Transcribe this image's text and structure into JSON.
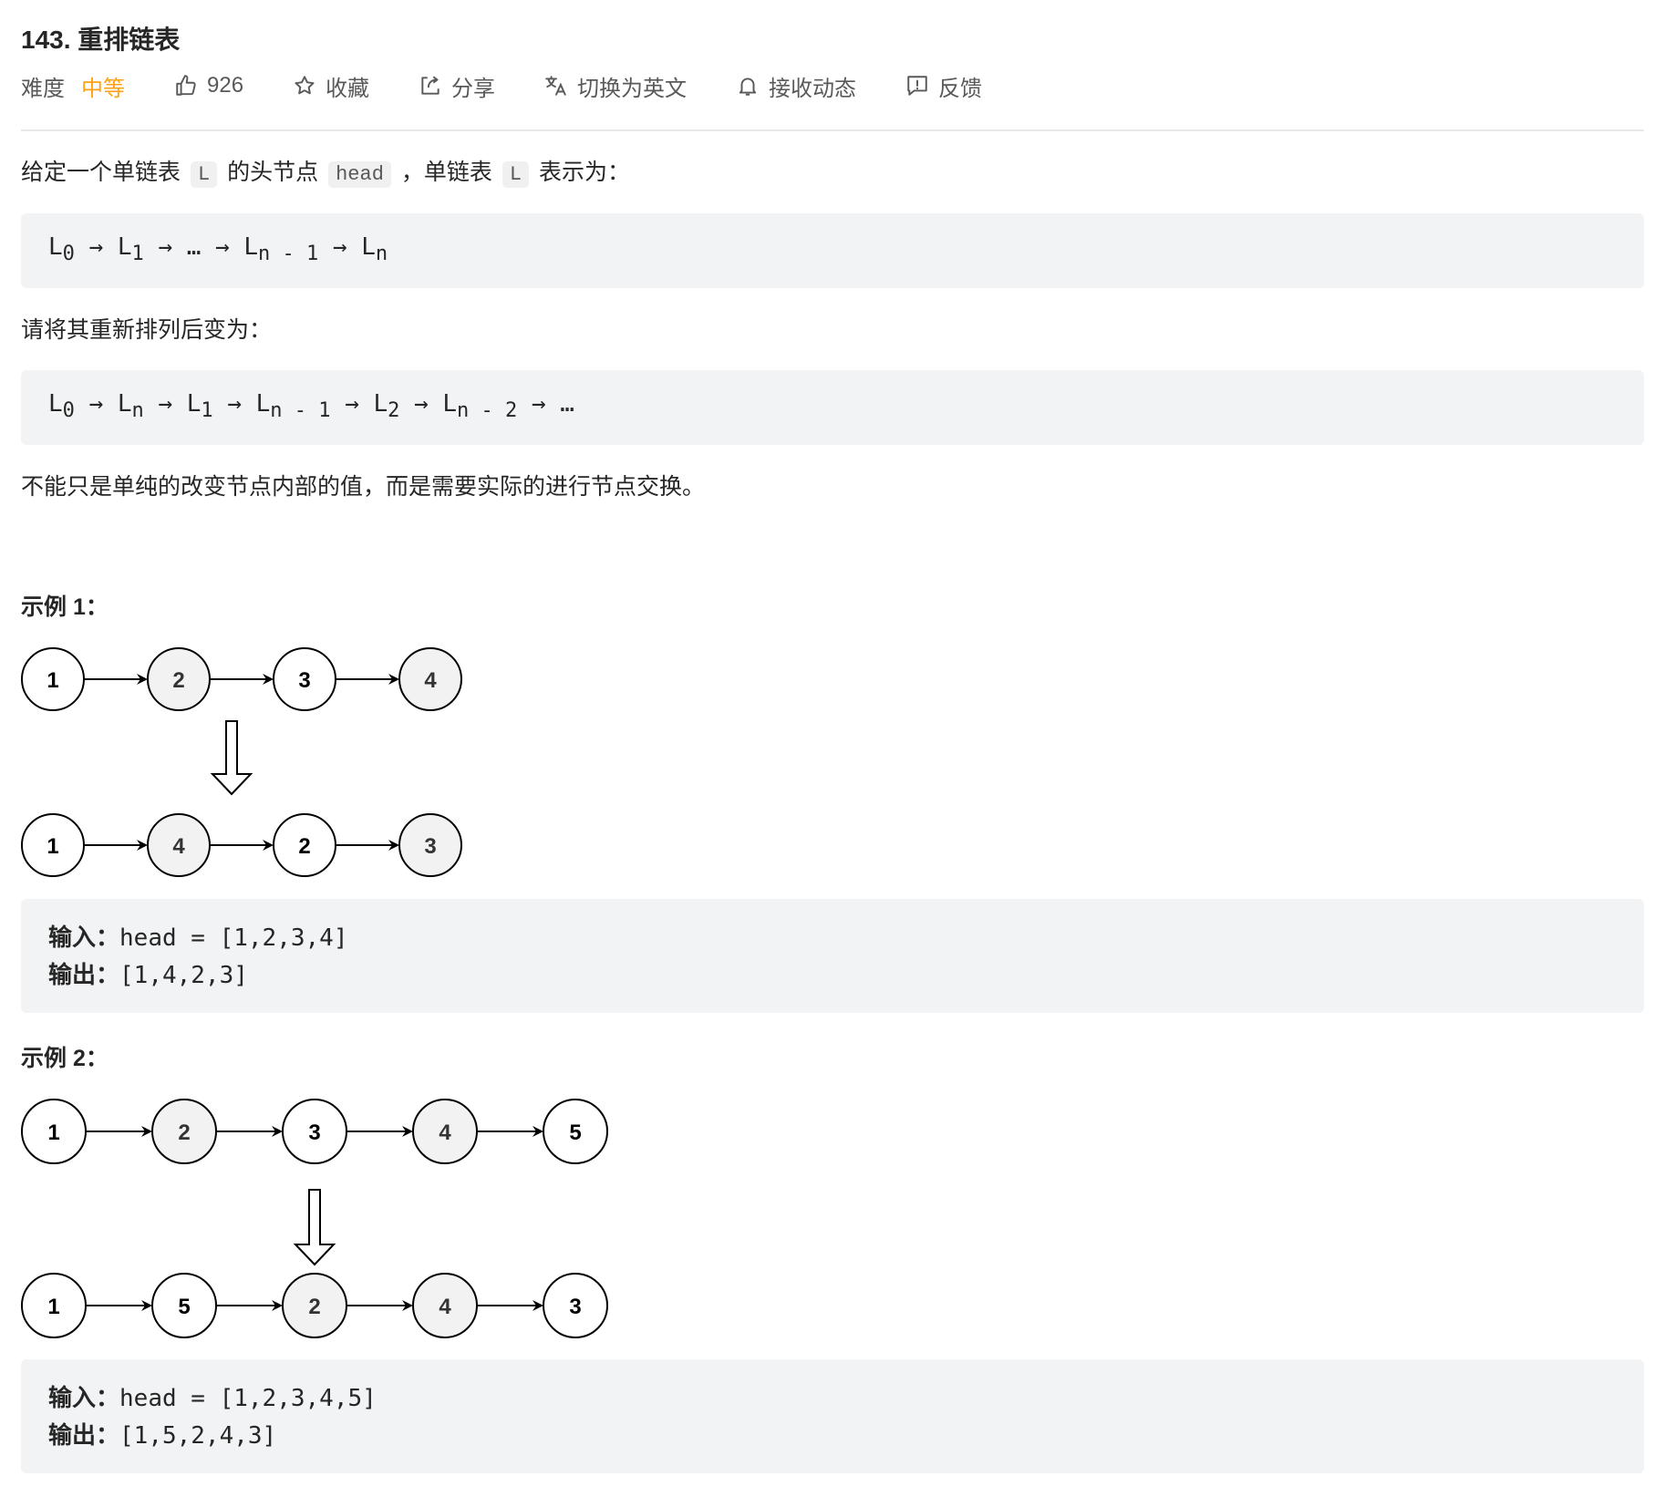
{
  "problem": {
    "title": "143. 重排链表",
    "difficulty_label": "难度",
    "difficulty_value": "中等",
    "likes": "926",
    "collect_label": "收藏",
    "share_label": "分享",
    "switch_lang_label": "切换为英文",
    "subscribe_label": "接收动态",
    "feedback_label": "反馈"
  },
  "desc": {
    "intro_pre": "给定一个单链表",
    "code_L": "L",
    "intro_mid": "的头节点",
    "code_head": "head",
    "intro_mid2": "，单链表",
    "code_L2": "L",
    "intro_post": "表示为：",
    "sequence1": "L0 → L1 → … → Ln - 1 → Ln",
    "reorder_text": "请将其重新排列后变为：",
    "sequence2": "L0 → Ln → L1 → Ln - 1 → L2 → Ln - 2 → …",
    "note": "不能只是单纯的改变节点内部的值，而是需要实际的进行节点交换。"
  },
  "examples": [
    {
      "title": "示例 1：",
      "before": [
        "1",
        "2",
        "3",
        "4"
      ],
      "after": [
        "1",
        "4",
        "2",
        "3"
      ],
      "input_label": "输入：",
      "input_value": "head = [1,2,3,4]",
      "output_label": "输出：",
      "output_value": "[1,4,2,3]"
    },
    {
      "title": "示例 2：",
      "before": [
        "1",
        "2",
        "3",
        "4",
        "5"
      ],
      "after": [
        "1",
        "5",
        "2",
        "4",
        "3"
      ],
      "input_label": "输入：",
      "input_value": "head = [1,2,3,4,5]",
      "output_label": "输出：",
      "output_value": "[1,5,2,4,3]"
    }
  ],
  "icons": {
    "like": "thumbs-up-icon",
    "collect": "star-icon",
    "share": "share-icon",
    "translate": "translate-icon",
    "subscribe": "bell-icon",
    "feedback": "feedback-icon"
  },
  "colors": {
    "difficulty_medium": "#ffa116",
    "code_bg": "#f2f3f4",
    "node_highlight": "#f2f2f2"
  }
}
